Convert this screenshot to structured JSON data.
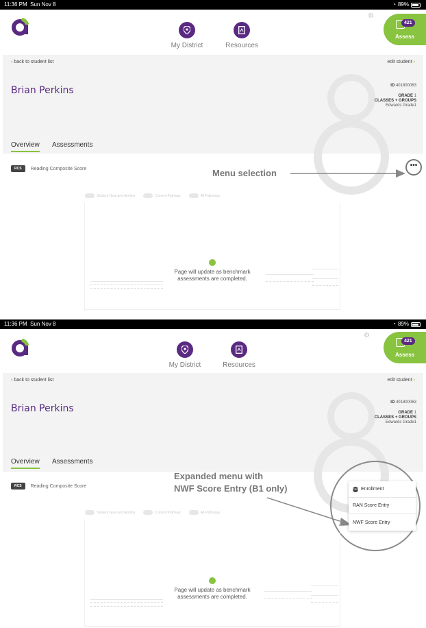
{
  "status_bar": {
    "time": "11:36 PM",
    "date": "Sun Nov 8",
    "battery": "89%"
  },
  "nav": {
    "my_district": "My District",
    "resources": "Resources"
  },
  "assess": {
    "badge": "421",
    "label": "Assess"
  },
  "student": {
    "back_label": "back to student list",
    "edit_label": "edit student",
    "name": "Brian Perkins",
    "id_label": "ID",
    "id_value": "401800063",
    "grade_label": "GRADE",
    "grade_value": "1",
    "classes_label": "CLASSES + GROUPS",
    "classes_value": "Edwards Grade1"
  },
  "tabs": {
    "overview": "Overview",
    "assessments": "Assessments"
  },
  "score": {
    "badge": "RCS",
    "label": "Reading Composite Score"
  },
  "toggles": {
    "goal": "Student Goal and Aimline",
    "current": "Current Pathway",
    "all": "All Pathways"
  },
  "chart_message": {
    "line1": "Page will update as benchmark",
    "line2": "assessments are completed."
  },
  "menu_dots": "•••",
  "annotations": {
    "menu_selection": "Menu selection",
    "expanded_line1": "Expanded menu with",
    "expanded_line2": "NWF Score Entry (B1 only)"
  },
  "dropdown": {
    "enrollment_icon": "PRE",
    "enrollment": "Enrollment",
    "ran": "RAN Score Entry",
    "nwf": "NWF Score Entry"
  },
  "colors": {
    "brand_purple": "#5a2a82",
    "brand_green": "#88c43f"
  }
}
